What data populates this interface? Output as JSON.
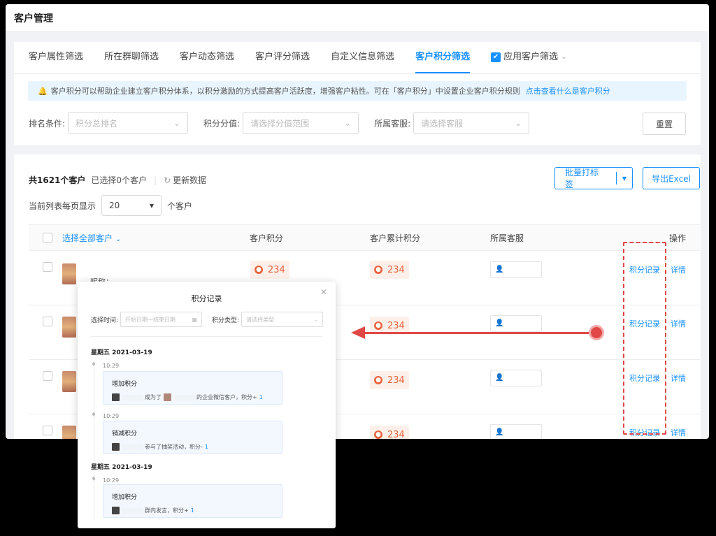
{
  "title": "客户管理",
  "tabs": [
    {
      "label": "客户属性筛选"
    },
    {
      "label": "所在群聊筛选"
    },
    {
      "label": "客户动态筛选"
    },
    {
      "label": "客户评分筛选"
    },
    {
      "label": "自定义信息筛选"
    },
    {
      "label": "客户积分筛选"
    },
    {
      "label": "应用客户筛选"
    }
  ],
  "notice": {
    "text": "客户积分可以帮助企业建立客户积分体系，以积分激励的方式提高客户活跃度，增强客户粘性。可在「客户积分」中设置企业客户积分规则",
    "link": "点击查看什么是客户积分"
  },
  "filters": {
    "rank_label": "排名条件:",
    "rank_placeholder": "积分总排名",
    "value_label": "积分分值:",
    "value_placeholder": "请选择分值范围",
    "agent_label": "所属客服:",
    "agent_placeholder": "请选择客服",
    "reset": "重置"
  },
  "summary": {
    "total": "共1621个客户",
    "selected": "已选择0个客户",
    "refresh": "更新数据"
  },
  "pager": {
    "prefix": "当前列表每页显示",
    "size": "20",
    "suffix": "个客户"
  },
  "actions": {
    "batch_tag": "批量打标签",
    "export": "导出Excel"
  },
  "table": {
    "headers": {
      "select_all": "选择全部客户",
      "points": "客户积分",
      "total_points": "客户累计积分",
      "agent": "所属客服",
      "ops": "操作"
    },
    "rows": [
      {
        "points": "234",
        "total": "234",
        "nickname": "昵称：",
        "op1": "积分记录",
        "op2": "详情"
      },
      {
        "points": "",
        "total": "234",
        "op1": "积分记录",
        "op2": "详情"
      },
      {
        "points": "",
        "total": "234",
        "op1": "积分记录",
        "op2": "详情"
      },
      {
        "points": "",
        "total": "234",
        "op1": "积分记录",
        "op2": "详情"
      }
    ]
  },
  "modal": {
    "title": "积分记录",
    "time_label": "选择时间:",
    "time_placeholder": "开始日期～结束日期",
    "type_label": "积分类型:",
    "type_placeholder": "请选择类型",
    "groups": [
      {
        "date": "星期五 2021-03-19",
        "records": [
          {
            "time": "10:29",
            "title": "增加积分",
            "desc_a": "成为了",
            "desc_b": "的企业微信客户，积分+",
            "amount": "1"
          },
          {
            "time": "10:29",
            "title": "销减积分",
            "desc_a": "参与了抽奖活动，积分-",
            "desc_b": "",
            "amount": "1"
          }
        ]
      },
      {
        "date": "星期五 2021-03-19",
        "records": [
          {
            "time": "10:29",
            "title": "增加积分",
            "desc_a": "群内发言，积分+",
            "desc_b": "",
            "amount": "1"
          }
        ]
      }
    ]
  }
}
